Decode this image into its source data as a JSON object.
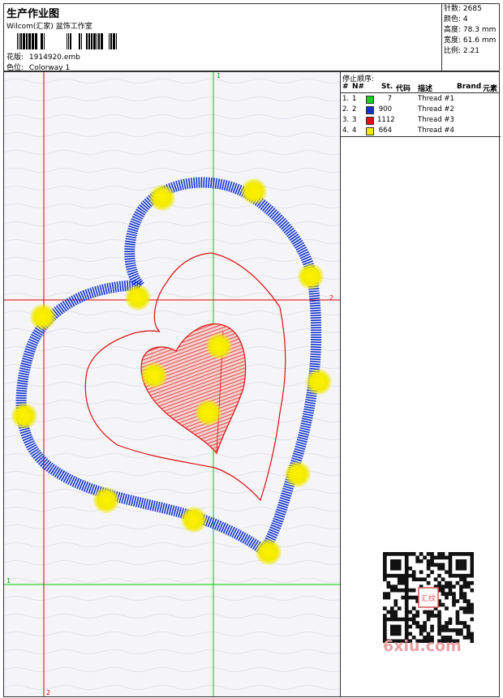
{
  "header": {
    "title": "生产作业图",
    "company": "Wilcom(汇家) 盆饰工作室",
    "design_label": "花版:",
    "design_value": "1914920.emb",
    "colorway_label": "色位:",
    "colorway_value": "Colorway 1"
  },
  "stats": [
    {
      "label": "针数:",
      "value": "2685"
    },
    {
      "label": "颜色:",
      "value": "4"
    },
    {
      "label": "高度:",
      "value": "78.3 mm"
    },
    {
      "label": "宽度:",
      "value": "61.6 mm"
    },
    {
      "label": "比例:",
      "value": "2.21"
    }
  ],
  "stop_sequence": {
    "title": "停止顺序:",
    "columns": [
      "#",
      "N#",
      "St.",
      "代码",
      "描述",
      "Brand",
      "元素"
    ],
    "rows": [
      {
        "num": "1.",
        "n": "1",
        "color": "#22cc22",
        "stitches": "7",
        "desc": "Thread #1"
      },
      {
        "num": "2.",
        "n": "2",
        "color": "#1133cc",
        "stitches": "900",
        "desc": "Thread #2"
      },
      {
        "num": "3.",
        "n": "3",
        "color": "#dd1111",
        "stitches": "1112",
        "desc": "Thread #3"
      },
      {
        "num": "4.",
        "n": "4",
        "color": "#f2ea00",
        "stitches": "664",
        "desc": "Thread #4"
      }
    ]
  },
  "guides": {
    "v1_label": "1",
    "h2_label": "2",
    "h1_label": "1",
    "v2_label": "2"
  },
  "watermark": "6xiu.com",
  "qr_center_text": "汇纹",
  "colors": {
    "guide_green": "#00cc00",
    "guide_red": "#dd0000",
    "thread_blue": "#1133cc",
    "thread_red": "#dd1111",
    "thread_yellow": "#f2ea00"
  }
}
